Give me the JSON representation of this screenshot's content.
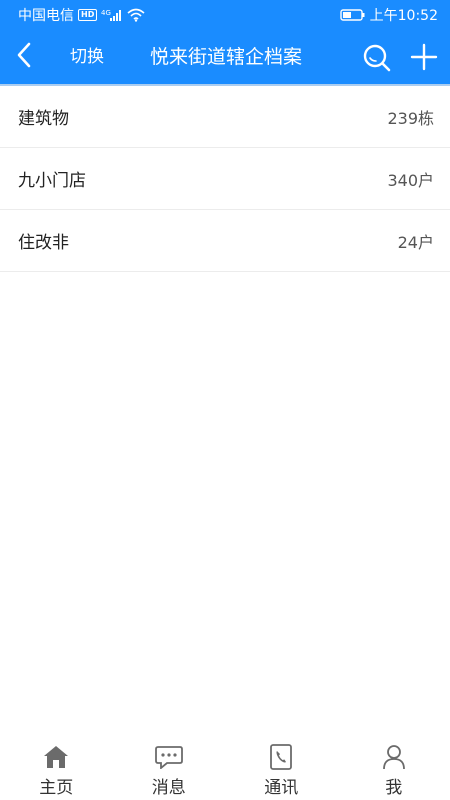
{
  "status_bar": {
    "carrier": "中国电信",
    "hd": "HD",
    "network": "4G",
    "time": "上午10:52"
  },
  "nav": {
    "back_icon": "chevron-left-icon",
    "switch_label": "切换",
    "title": "悦来街道辖企档案",
    "search_icon": "search-icon",
    "add_icon": "plus-icon"
  },
  "list": {
    "items": [
      {
        "label": "建筑物",
        "count": "239栋"
      },
      {
        "label": "九小门店",
        "count": "340户"
      },
      {
        "label": "住改非",
        "count": "24户"
      }
    ]
  },
  "tabs": [
    {
      "label": "主页",
      "icon": "home-icon"
    },
    {
      "label": "消息",
      "icon": "message-icon"
    },
    {
      "label": "通讯",
      "icon": "phone-book-icon"
    },
    {
      "label": "我",
      "icon": "user-icon"
    }
  ],
  "colors": {
    "primary": "#1a8cff",
    "tab_icon": "#6b6b6b",
    "text": "#222222"
  }
}
